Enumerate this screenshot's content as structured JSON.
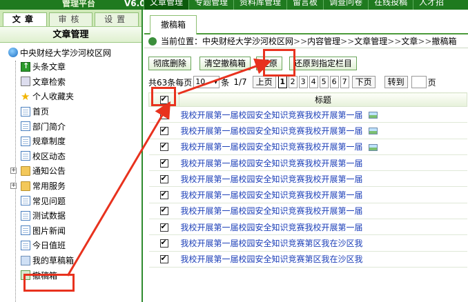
{
  "topbar": {
    "brand": "管理平台",
    "version": "V6.0",
    "nav": [
      "文章管理",
      "专题管理",
      "资料库管理",
      "留言板",
      "调查问卷",
      "在线投稿",
      "人才招"
    ]
  },
  "left": {
    "tabs": [
      "文章",
      "审核",
      "设置"
    ],
    "title": "文章管理",
    "root": "中央财经大学沙河校区网",
    "items": [
      {
        "label": "头条文章",
        "icon": "green-up-icon"
      },
      {
        "label": "文章检索",
        "icon": "search-icon"
      },
      {
        "label": "个人收藏夹",
        "icon": "star-icon"
      },
      {
        "label": "首页",
        "icon": "page-icon"
      },
      {
        "label": "部门简介",
        "icon": "page-icon"
      },
      {
        "label": "规章制度",
        "icon": "page-icon"
      },
      {
        "label": "校区动态",
        "icon": "page-icon"
      },
      {
        "label": "通知公告",
        "icon": "folder-icon",
        "expander": "+"
      },
      {
        "label": "常用服务",
        "icon": "folder-icon",
        "expander": "+"
      },
      {
        "label": "常见问题",
        "icon": "page-icon"
      },
      {
        "label": "测试数据",
        "icon": "page-icon"
      },
      {
        "label": "图片新闻",
        "icon": "page-icon"
      },
      {
        "label": "今日值班",
        "icon": "page-icon"
      },
      {
        "label": "我的草稿箱",
        "icon": "draft-icon"
      },
      {
        "label": "撤稿箱",
        "icon": "trash-icon"
      }
    ]
  },
  "main": {
    "tab": "撤稿箱",
    "location": {
      "prefix": "当前位置：",
      "crumbs": [
        "中央财经大学沙河校区网",
        "内容管理",
        "文章管理",
        "文章",
        "撤稿箱"
      ],
      "sep": ">>"
    },
    "toolbar": {
      "delete_all": "彻底删除",
      "clear": "清空撤稿箱",
      "restore": "还原",
      "restore_to": "还原到指定栏目"
    },
    "pager": {
      "total": "共63条",
      "per_page_label": "每页",
      "per_page_value": "10",
      "unit": "条",
      "page_info": "1/7",
      "prev": "上页",
      "pages": [
        "1",
        "2",
        "3",
        "4",
        "5",
        "6",
        "7"
      ],
      "next": "下页",
      "goto": "转到",
      "page_suffix": "页"
    },
    "table": {
      "header": "标题",
      "rows": [
        {
          "title": "我校开展第一届校园安全知识竞赛我校开展第一届",
          "has_image": true
        },
        {
          "title": "我校开展第一届校园安全知识竞赛我校开展第一届",
          "has_image": true
        },
        {
          "title": "我校开展第一届校园安全知识竞赛我校开展第一届",
          "has_image": true
        },
        {
          "title": "我校开展第一届校园安全知识竞赛我校开展第一届",
          "has_image": false
        },
        {
          "title": "我校开展第一届校园安全知识竞赛我校开展第一届",
          "has_image": false
        },
        {
          "title": "我校开展第一届校园安全知识竞赛我校开展第一届",
          "has_image": false
        },
        {
          "title": "我校开展第一届校园安全知识竞赛我校开展第一届",
          "has_image": false
        },
        {
          "title": "我校开展第一届校园安全知识竞赛我校开展第一届",
          "has_image": false
        },
        {
          "title": "我校开展第一届校园安全知识竞赛第区我在沙区我",
          "has_image": false
        },
        {
          "title": "我校开展第一届校园安全知识竞赛第区我在沙区我",
          "has_image": false
        }
      ]
    }
  },
  "colors": {
    "annotation": "#e8321e",
    "link": "#1c3fb8",
    "nav_green": "#1f7a1f"
  }
}
